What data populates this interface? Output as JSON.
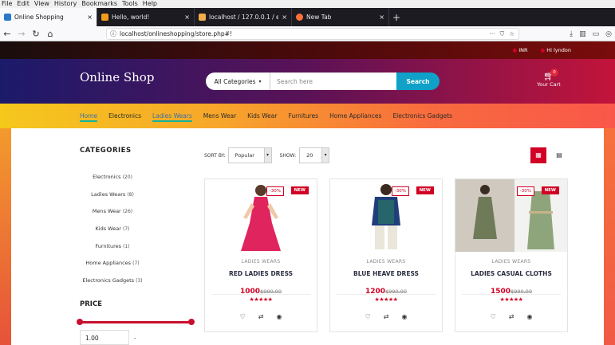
{
  "browser": {
    "menu": [
      "File",
      "Edit",
      "View",
      "History",
      "Bookmarks",
      "Tools",
      "Help"
    ],
    "tabs": [
      {
        "label": "Online Shopping",
        "close": "×",
        "color": "#2a78c8"
      },
      {
        "label": "Hello, world!",
        "close": "×",
        "color": "#f29d1a"
      },
      {
        "label": "localhost / 127.0.0.1 / ecomme",
        "close": "×",
        "color": "#f0ad4e"
      },
      {
        "label": "New Tab",
        "close": "×",
        "color": "#ff7139"
      }
    ],
    "newtab": "+",
    "url": "localhost/onlineshopping/store.php#!",
    "url_actions": "···"
  },
  "topbar": {
    "currency": "INR",
    "greeting": "Hi lyndon"
  },
  "header": {
    "logo": "Online Shop",
    "category_select": "All Categories",
    "search_placeholder": "Search here",
    "search_button": "Search",
    "cart_label": "Your Cart",
    "cart_count": "0"
  },
  "nav": [
    "Home",
    "Electronics",
    "Ladies Wears",
    "Mens Wear",
    "Kids Wear",
    "Furnitures",
    "Home Appliances",
    "Electronics Gadgets"
  ],
  "sidebar": {
    "categories_title": "CATEGORIES",
    "categories": [
      {
        "name": "Electronics",
        "count": "(20)"
      },
      {
        "name": "Ladies Wears",
        "count": "(8)"
      },
      {
        "name": "Mens Wear",
        "count": "(26)"
      },
      {
        "name": "Kids Wear",
        "count": "(7)"
      },
      {
        "name": "Furnitures",
        "count": "(1)"
      },
      {
        "name": "Home Appliances",
        "count": "(7)"
      },
      {
        "name": "Electronics Gadgets",
        "count": "(3)"
      }
    ],
    "price_title": "PRICE",
    "price_min": "1.00",
    "price_separator": "-"
  },
  "store": {
    "sort_label": "SORT BY:",
    "sort_value": "Popular",
    "show_label": "SHOW:",
    "show_value": "20",
    "accent": "#d10024"
  },
  "products": [
    {
      "discount": "-30%",
      "badge": "NEW",
      "category": "LADIES WEARS",
      "name": "RED LADIES DRESS",
      "price": "1000",
      "old_price": "$990.00",
      "stars": "★★★★★"
    },
    {
      "discount": "-30%",
      "badge": "NEW",
      "category": "LADIES WEARS",
      "name": "BLUE HEAVE DRESS",
      "price": "1200",
      "old_price": "$990.00",
      "stars": "★★★★★"
    },
    {
      "discount": "-30%",
      "badge": "NEW",
      "category": "LADIES WEARS",
      "name": "LADIES CASUAL CLOTHS",
      "price": "1500",
      "old_price": "$990.00",
      "stars": "★★★★★"
    }
  ],
  "icons": {
    "wishlist": "♡",
    "compare": "⇄",
    "quickview": "◉"
  }
}
